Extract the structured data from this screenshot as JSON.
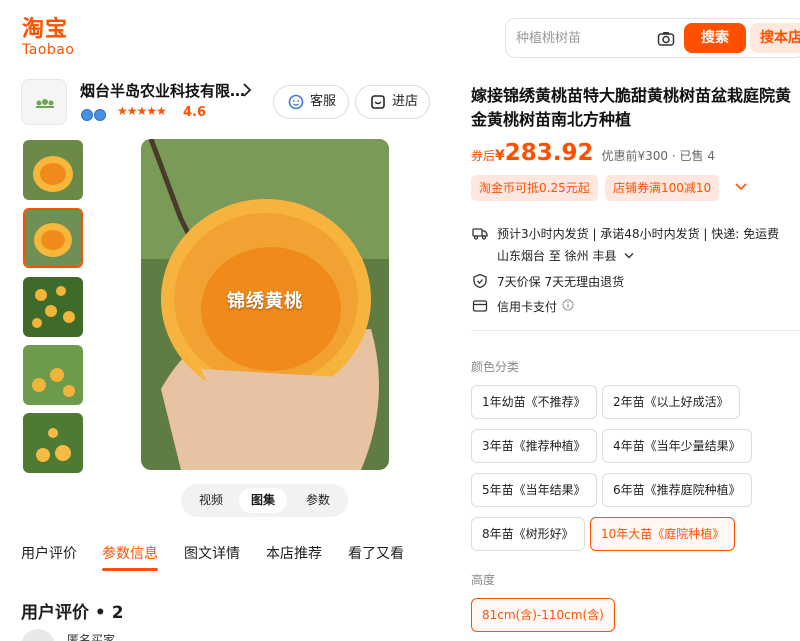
{
  "header": {
    "logo_cn": "淘宝",
    "logo_en": "Taobao",
    "search_placeholder": "种植桃树苗",
    "search_button": "搜索",
    "store_search_button": "搜本店"
  },
  "shop": {
    "name": "烟台半岛农业科技有限…",
    "rating": "4.6",
    "stars": "★★★★★",
    "service_button": "客服",
    "store_button": "进店"
  },
  "gallery": {
    "caption": "锦绣黄桃",
    "view_tabs": [
      "视频",
      "图集",
      "参数"
    ]
  },
  "tabs": [
    "用户评价",
    "参数信息",
    "图文详情",
    "本店推荐",
    "看了又看"
  ],
  "active_tab": "参数信息",
  "reviews": {
    "title": "用户评价 • 2",
    "user": "匿名买家"
  },
  "product": {
    "title": "嫁接锦绣黄桃苗特大脆甜黄桃树苗盆栽庭院黄金黄桃树苗南北方种植",
    "price_prefix": "券后",
    "price_currency": "¥",
    "price": "283.92",
    "price_meta": "优惠前¥300 · 已售 4",
    "coupons": [
      "淘金币可抵0.25元起",
      "店铺券满100减10"
    ],
    "delivery": "预计3小时内发货 | 承诺48小时内发货 | 快递: 免运费",
    "route": "山东烟台 至 徐州 丰县",
    "guarantee": "7天价保  7天无理由退货",
    "payment": "信用卡支付"
  },
  "color_section": {
    "label": "颜色分类",
    "options": [
      "1年幼苗《不推荐》",
      "2年苗《以上好成活》",
      "3年苗《推荐种植》",
      "4年苗《当年少量结果》",
      "5年苗《当年结果》",
      "6年苗《推荐庭院种植》",
      "8年苗《树形好》",
      "10年大苗《庭院种植》"
    ],
    "selected": "10年大苗《庭院种植》"
  },
  "height_section": {
    "label": "高度",
    "options": [
      "81cm(含)-110cm(含)"
    ],
    "selected": "81cm(含)-110cm(含)"
  },
  "colors": {
    "accent": "#ff5000",
    "coupon_bg": "#ffe7df"
  }
}
